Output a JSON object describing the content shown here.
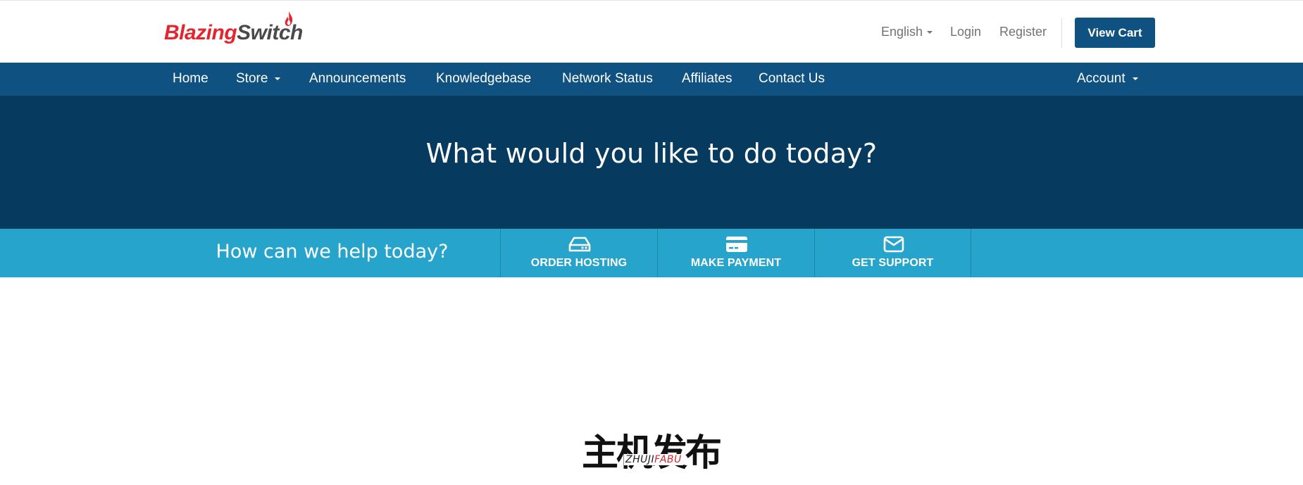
{
  "header": {
    "logo_part1": "Blazing",
    "logo_part2": "Switch",
    "language": "English",
    "login": "Login",
    "register": "Register",
    "view_cart": "View Cart"
  },
  "nav": {
    "items": [
      "Home",
      "Store",
      "Announcements",
      "Knowledgebase",
      "Network Status",
      "Affiliates",
      "Contact Us"
    ],
    "account": "Account"
  },
  "hero": {
    "title": "What would you like to do today?"
  },
  "help": {
    "title": "How can we help today?",
    "actions": [
      {
        "label": "ORDER HOSTING",
        "icon": "hdd-icon"
      },
      {
        "label": "MAKE PAYMENT",
        "icon": "credit-card-icon"
      },
      {
        "label": "GET SUPPORT",
        "icon": "envelope-icon"
      }
    ]
  },
  "footer_brand": {
    "cn": "主机发布",
    "en_part1": "ZHUJI",
    "en_part2": "FABU"
  },
  "colors": {
    "nav_bg": "#0f5180",
    "hero_bg": "#063a5f",
    "help_bg": "#26a4cb",
    "logo_red": "#e3262e"
  }
}
